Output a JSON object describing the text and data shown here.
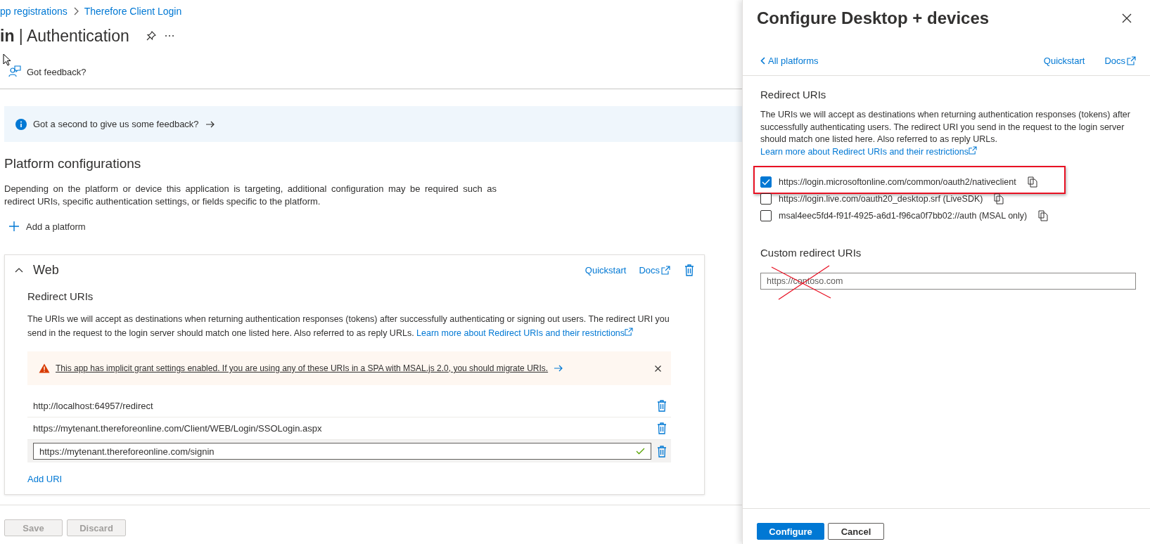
{
  "breadcrumb": [
    {
      "label": "pp registrations"
    },
    {
      "label": "Therefore Client Login"
    }
  ],
  "title": "**in** | Authentication",
  "feedback_link": "Got feedback?",
  "info_bar": "Got a second to give us some feedback?",
  "platforms": {
    "title": "Platform configurations",
    "description": "Depending on the platform or device this application is targeting, additional configuration may be required such as redirect URIs, specific authentication settings, or fields specific to the platform.",
    "add_platform": "Add a platform"
  },
  "web_card": {
    "title": "Web",
    "expanded": true,
    "quickstart": "Quickstart",
    "docs": "Docs",
    "redirect_title": "Redirect URIs",
    "description": "The URIs we will accept as destinations when returning authentication responses (tokens) after successfully authenticating or signing out users. The redirect URI you send in the request to the login server should match one listed here. Also referred to as reply URLs.",
    "learn_link": "Learn more about Redirect URIs and their restrictions",
    "warning": "This app has implicit grant settings enabled. If you are using any of these URIs in a SPA with MSAL.js 2.0, you should migrate URIs.",
    "uris": [
      {
        "kind": "text",
        "value": "http://localhost:64957/redirect"
      },
      {
        "kind": "text",
        "value": "https://mytenant.thereforeonline.com/Client/WEB/Login/SSOLogin.aspx"
      },
      {
        "kind": "input",
        "value": "https://mytenant.thereforeonline.com/signin",
        "valid": true
      }
    ],
    "add_uri": "Add URI"
  },
  "footer_buttons": [
    {
      "label": "Save",
      "disabled": true
    },
    {
      "label": "Discard",
      "disabled": true
    }
  ],
  "panel": {
    "title": "Configure Desktop + devices",
    "back_link": "All platforms",
    "quickstart": "Quickstart",
    "docs": "Docs",
    "redirect_title": "Redirect URIs",
    "description": "The URIs we will accept as destinations when returning authentication responses (tokens) after successfully authenticating users. The redirect URI you send in the request to the login server should match one listed here. Also referred to as reply URLs.",
    "learn_link": "Learn more about Redirect URIs and their restrictions",
    "options": [
      {
        "uri": "https://login.microsoftonline.com/common/oauth2/nativeclient",
        "checked": true,
        "highlighted": true
      },
      {
        "uri": "https://login.live.com/oauth20_desktop.srf (LiveSDK)",
        "checked": false,
        "highlighted": false
      },
      {
        "uri": "msal4eec5fd4-f91f-4925-a6d1-f96ca0f7bb02://auth (MSAL only)",
        "checked": false,
        "highlighted": false
      }
    ],
    "custom_title": "Custom redirect URIs",
    "custom_placeholder": "https://contoso.com",
    "custom_crossed_out": true,
    "buttons": [
      {
        "label": "Configure",
        "kind": "primary"
      },
      {
        "label": "Cancel",
        "kind": "default"
      }
    ]
  }
}
